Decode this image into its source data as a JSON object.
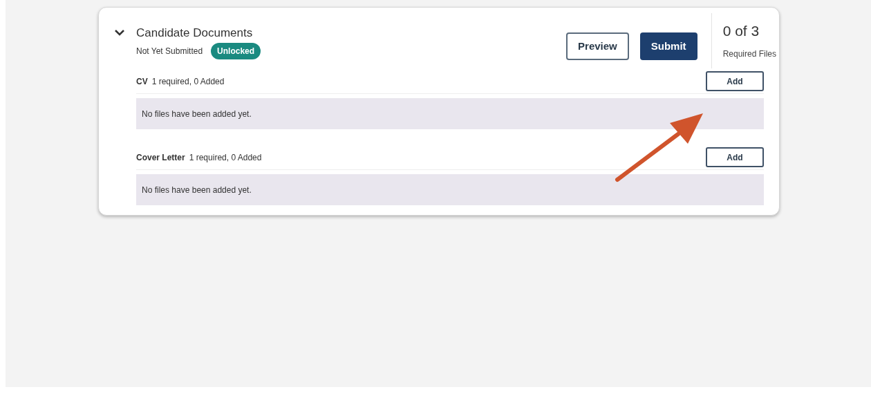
{
  "section": {
    "title": "Candidate Documents",
    "expanded": true,
    "status": "Not Yet Submitted",
    "badge": "Unlocked",
    "buttons": [
      {
        "label": "Preview",
        "kind": "outline"
      },
      {
        "label": "Submit",
        "kind": "primary"
      }
    ],
    "count": "0 of 3",
    "count_label": "Required Files"
  },
  "documents": [
    {
      "name": "CV",
      "requirement": "1 required, 0 Added",
      "button": "Add",
      "empty_message": "No files have been added yet."
    },
    {
      "name": "Cover Letter",
      "requirement": "1 required, 0 Added",
      "button": "Add",
      "empty_message": "No files have been added yet."
    }
  ]
}
